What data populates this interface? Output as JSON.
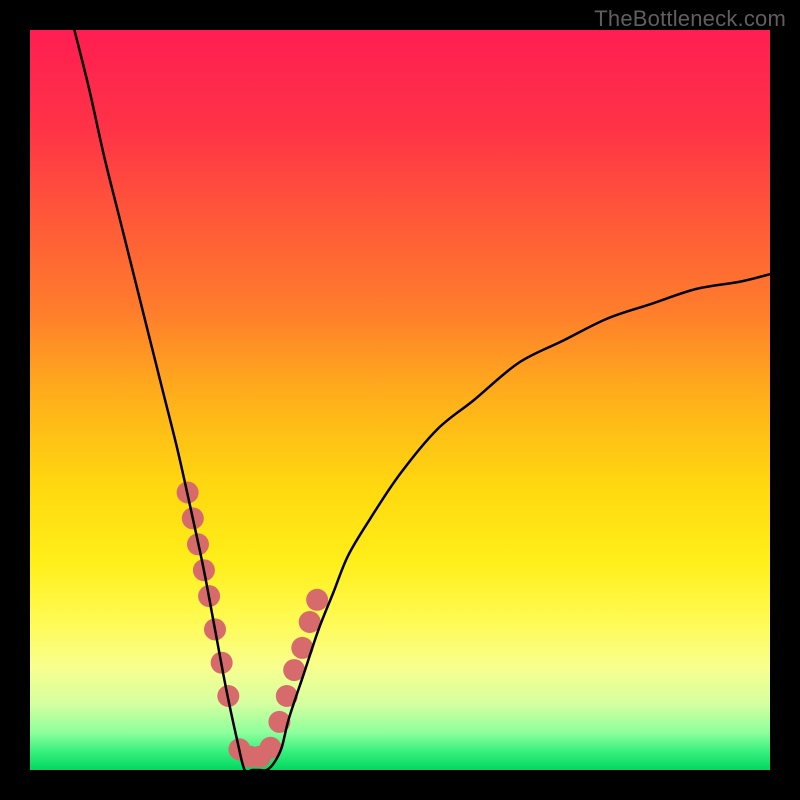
{
  "watermark": "TheBottleneck.com",
  "chart_data": {
    "type": "line",
    "title": "",
    "xlabel": "",
    "ylabel": "",
    "xlim": [
      0,
      100
    ],
    "ylim": [
      0,
      100
    ],
    "grid": false,
    "legend": false,
    "background_gradient_stops": [
      {
        "offset": 0.0,
        "color": "#ff1e52"
      },
      {
        "offset": 0.13,
        "color": "#ff3247"
      },
      {
        "offset": 0.26,
        "color": "#ff5a38"
      },
      {
        "offset": 0.38,
        "color": "#ff7d2c"
      },
      {
        "offset": 0.5,
        "color": "#ffb11a"
      },
      {
        "offset": 0.62,
        "color": "#ffd90f"
      },
      {
        "offset": 0.72,
        "color": "#ffef1a"
      },
      {
        "offset": 0.8,
        "color": "#fffb55"
      },
      {
        "offset": 0.86,
        "color": "#f8ff8e"
      },
      {
        "offset": 0.91,
        "color": "#d6ffa0"
      },
      {
        "offset": 0.95,
        "color": "#8cff9c"
      },
      {
        "offset": 0.975,
        "color": "#38f07e"
      },
      {
        "offset": 1.0,
        "color": "#00d860"
      }
    ],
    "series": [
      {
        "name": "curve",
        "color": "#000000",
        "stroke_width": 2.5,
        "x": [
          6,
          8,
          10,
          12,
          14,
          16,
          18,
          20,
          22,
          23.5,
          25,
          26.5,
          28,
          29,
          30,
          31,
          32,
          33,
          34,
          35,
          37,
          39,
          41,
          43,
          46,
          50,
          55,
          60,
          66,
          72,
          78,
          84,
          90,
          96,
          100
        ],
        "y": [
          100,
          92,
          83,
          75,
          67,
          59,
          51,
          43,
          34,
          27,
          19,
          11,
          4,
          0,
          0,
          0,
          0,
          1,
          3,
          7,
          13,
          19,
          24,
          29,
          34,
          40,
          46,
          50,
          55,
          58,
          61,
          63,
          65,
          66,
          67
        ]
      }
    ],
    "markers": {
      "name": "highlight-dots",
      "color": "#d76b6b",
      "radius": 11,
      "x": [
        21.3,
        22.0,
        22.7,
        23.5,
        24.2,
        25.0,
        25.9,
        26.8,
        28.3,
        29.7,
        31.1,
        32.5,
        33.7,
        34.7,
        35.7,
        36.8,
        37.8,
        38.8
      ],
      "y": [
        37.5,
        34.0,
        30.5,
        27.0,
        23.5,
        19.0,
        14.5,
        10.0,
        2.8,
        1.8,
        1.8,
        3.0,
        6.5,
        10.0,
        13.5,
        16.5,
        20.0,
        23.0
      ]
    }
  }
}
